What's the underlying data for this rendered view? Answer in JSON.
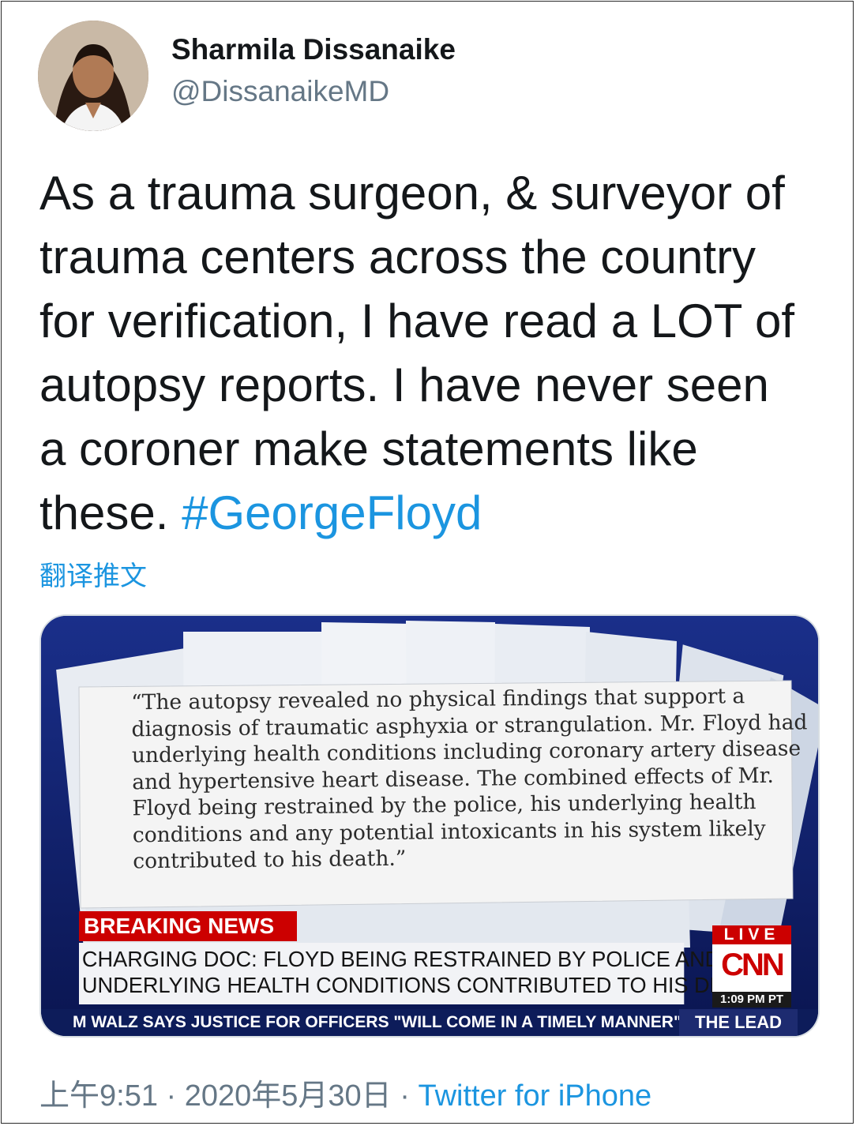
{
  "user": {
    "display_name": "Sharmila Dissanaike",
    "handle": "@DissanaikeMD"
  },
  "tweet": {
    "text_lines": [
      "As a trauma surgeon, & surveyor of",
      "trauma centers across the country",
      "for verification, I have read a LOT of",
      "autopsy reports. I have never seen",
      "a coroner make statements like",
      "these. "
    ],
    "hashtag": "#GeorgeFloyd",
    "translate_label": "翻译推文"
  },
  "media": {
    "quote_lines": [
      "“The autopsy revealed no physical findings that support a",
      "diagnosis of traumatic asphyxia or strangulation. Mr. Floyd had",
      "underlying health conditions including coronary artery disease",
      "and hypertensive heart disease. The combined effects of Mr.",
      "Floyd being restrained by the police, his underlying health",
      "conditions and any potential intoxicants in his system likely",
      "contributed to his death.”"
    ],
    "breaking_label": "BREAKING NEWS",
    "headline_lines": [
      "CHARGING DOC: FLOYD BEING RESTRAINED BY POLICE AND",
      "UNDERLYING HEALTH CONDITIONS CONTRIBUTED TO HIS DEATH"
    ],
    "live_label": "LIVE",
    "network_logo": "CNN",
    "clock": "1:09 PM PT",
    "ticker": "M WALZ SAYS JUSTICE FOR OFFICERS \"WILL COME IN A TIMELY MANNER\" AI",
    "show_name": "THE LEAD",
    "colors": {
      "breaking_red": "#cc0000",
      "ticker_navy": "#0d1c5a",
      "background_blue": "#0a1d6a"
    }
  },
  "footer": {
    "time": "上午9:51",
    "separator": "·",
    "date": "2020年5月30日",
    "source": "Twitter for iPhone"
  },
  "colors": {
    "link": "#1b95e0",
    "text": "#14171a",
    "muted": "#657786"
  }
}
